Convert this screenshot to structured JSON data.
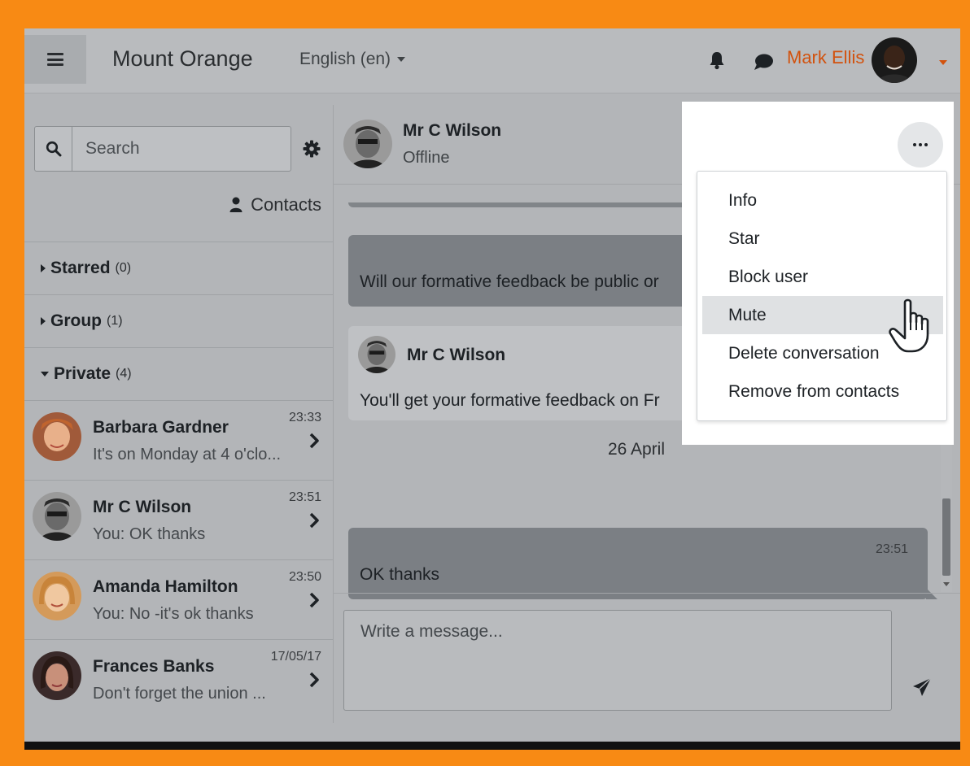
{
  "navbar": {
    "site_name": "Mount Orange",
    "language": "English (en)",
    "user_name": "Mark Ellis",
    "accent_color": "#d2520e"
  },
  "sidebar": {
    "search_placeholder": "Search",
    "contacts_label": "Contacts",
    "sections": [
      {
        "label": "Starred",
        "count": "(0)",
        "expanded": false
      },
      {
        "label": "Group",
        "count": "(1)",
        "expanded": false
      },
      {
        "label": "Private",
        "count": "(4)",
        "expanded": true
      }
    ],
    "conversations": [
      {
        "name": "Barbara Gardner",
        "time": "23:33",
        "preview": "It's on Monday at 4 o'clo..."
      },
      {
        "name": "Mr C Wilson",
        "time": "23:51",
        "preview": "You: OK thanks"
      },
      {
        "name": "Amanda Hamilton",
        "time": "23:50",
        "preview": "You: No -it's ok thanks"
      },
      {
        "name": "Frances Banks",
        "time": "17/05/17",
        "preview": "Don't forget the union ..."
      }
    ]
  },
  "conversation": {
    "contact_name": "Mr C Wilson",
    "status": "Offline",
    "messages": [
      {
        "type": "sent",
        "text": "Will our formative feedback be public or"
      },
      {
        "type": "received",
        "author": "Mr C Wilson",
        "text": "You'll get your formative feedback on Fr"
      },
      {
        "type": "sent",
        "time": "23:51",
        "text": "OK thanks"
      }
    ],
    "date_separator": "26 April",
    "composer_placeholder": "Write a message..."
  },
  "menu": {
    "items": [
      "Info",
      "Star",
      "Block user",
      "Mute",
      "Delete conversation",
      "Remove from contacts"
    ],
    "hovered": "Mute"
  }
}
